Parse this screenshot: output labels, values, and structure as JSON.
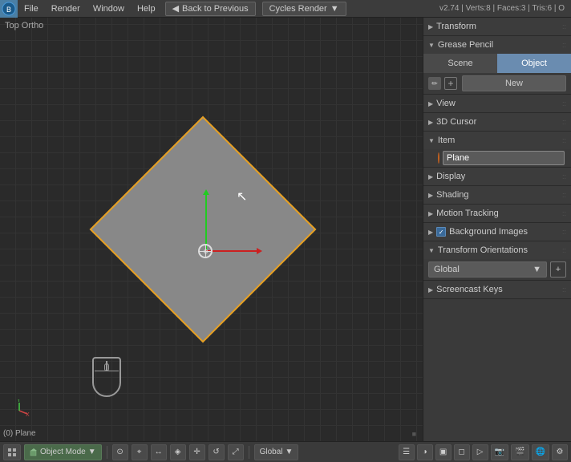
{
  "menubar": {
    "logo": "●",
    "items": [
      "File",
      "Render",
      "Window",
      "Help"
    ],
    "back_label": "Back to Previous",
    "render_engine": "Cycles Render",
    "version_info": "v2.74 | Verts:8 | Faces:3 | Tris:6 | O"
  },
  "viewport": {
    "label": "Top Ortho",
    "object_name": "(0) Plane"
  },
  "properties": {
    "transform_label": "Transform",
    "grease_pencil_label": "Grease Pencil",
    "tabs": [
      "Scene",
      "Object"
    ],
    "active_tab": "Object",
    "new_label": "New",
    "view_label": "View",
    "cursor_3d_label": "3D Cursor",
    "item_label": "Item",
    "item_name": "Plane",
    "display_label": "Display",
    "shading_label": "Shading",
    "motion_tracking_label": "Motion Tracking",
    "background_images_label": "Background Images",
    "transform_orientations_label": "Transform Orientations",
    "global_label": "Global",
    "screencast_keys_label": "Screencast Keys"
  },
  "bottom_bar": {
    "mode_label": "Object Mode",
    "global_label": "Global"
  }
}
